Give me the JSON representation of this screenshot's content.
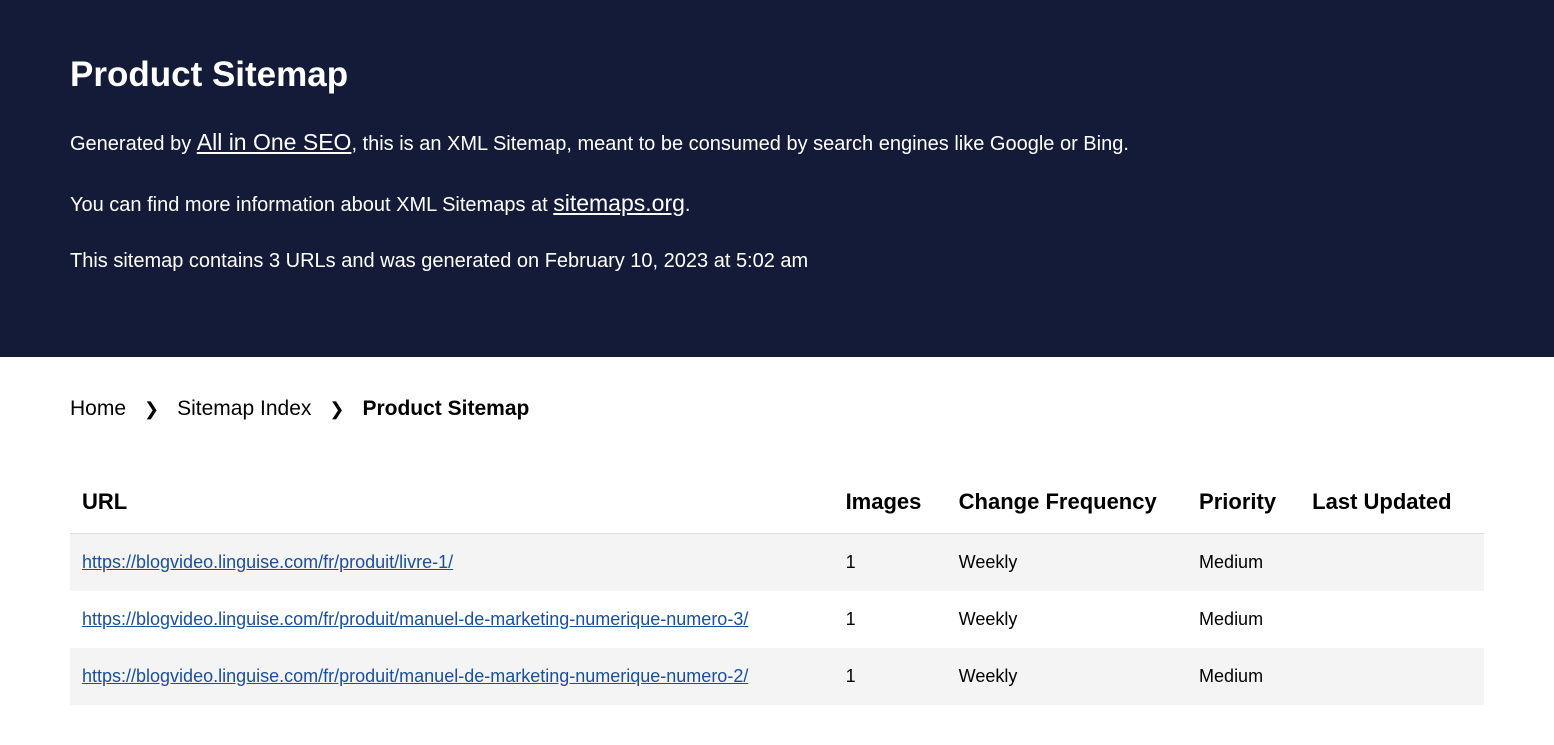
{
  "header": {
    "title": "Product Sitemap",
    "line1_prefix": "Generated by ",
    "line1_link": "All in One SEO",
    "line1_suffix": ", this is an XML Sitemap, meant to be consumed by search engines like Google or Bing.",
    "line2_prefix": "You can find more information about XML Sitemaps at ",
    "line2_link": "sitemaps.org",
    "line2_suffix": ".",
    "line3": "This sitemap contains 3 URLs and was generated on February 10, 2023 at 5:02 am"
  },
  "breadcrumb": {
    "items": [
      {
        "label": "Home"
      },
      {
        "label": "Sitemap Index"
      },
      {
        "label": "Product Sitemap"
      }
    ]
  },
  "table": {
    "columns": {
      "url": "URL",
      "images": "Images",
      "freq": "Change Frequency",
      "priority": "Priority",
      "updated": "Last Updated"
    },
    "rows": [
      {
        "url": "https://blogvideo.linguise.com/fr/produit/livre-1/",
        "images": "1",
        "freq": "Weekly",
        "priority": "Medium",
        "updated": ""
      },
      {
        "url": "https://blogvideo.linguise.com/fr/produit/manuel-de-marketing-numerique-numero-3/",
        "images": "1",
        "freq": "Weekly",
        "priority": "Medium",
        "updated": ""
      },
      {
        "url": "https://blogvideo.linguise.com/fr/produit/manuel-de-marketing-numerique-numero-2/",
        "images": "1",
        "freq": "Weekly",
        "priority": "Medium",
        "updated": ""
      }
    ]
  }
}
